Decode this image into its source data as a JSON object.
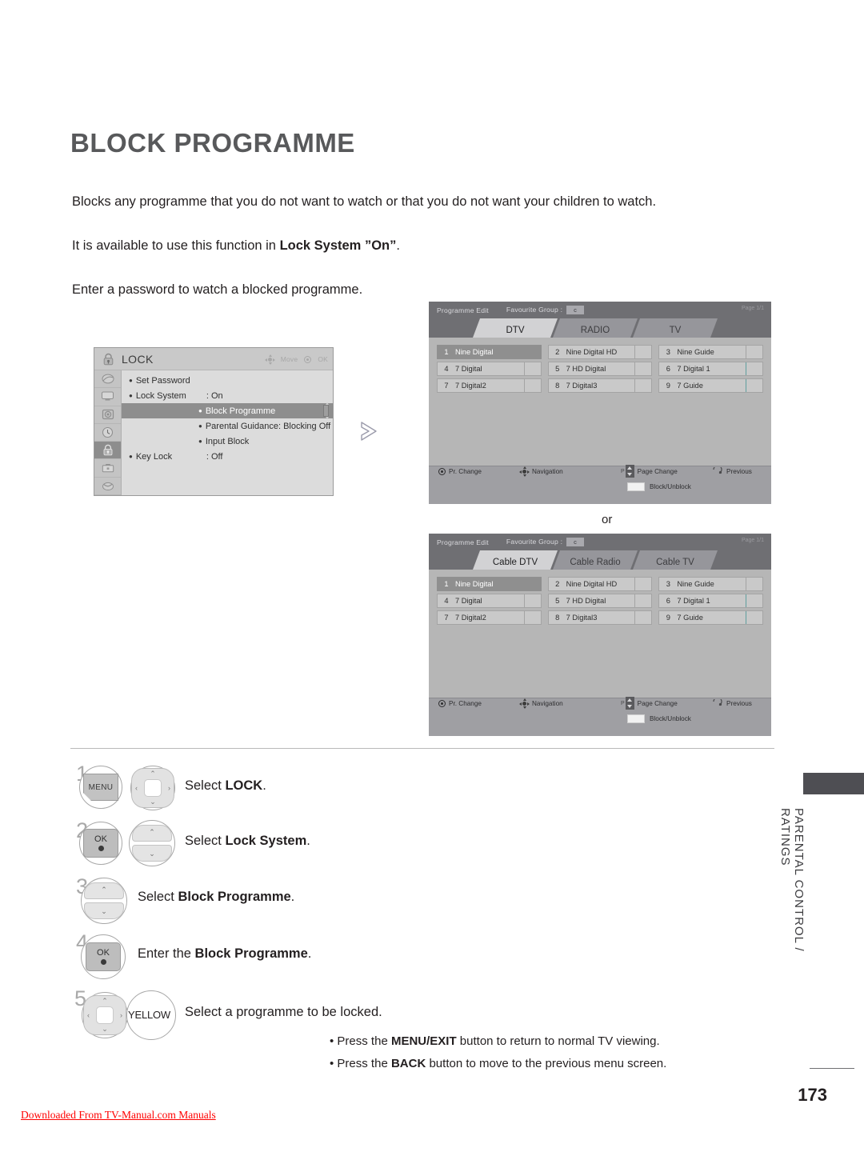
{
  "document": {
    "title": "BLOCK PROGRAMME",
    "intro": [
      "Blocks any programme that you do not want to watch or that you do not want your children to watch.",
      "It is available to use this function in ",
      "Enter a password to watch a blocked programme."
    ],
    "intro_bold": "Lock System ”On”",
    "intro_tail": ".",
    "page_number": "173",
    "download_note": "Downloaded From TV-Manual.com Manuals",
    "or_label": "or"
  },
  "side_tab": {
    "line1": "PARENTAL CONTROL /",
    "line2": "RATINGS"
  },
  "lock_menu": {
    "title": "LOCK",
    "hint_move": "Move",
    "hint_ok": "OK",
    "rail_icons": [
      "picture-icon",
      "screen-icon",
      "audio-icon",
      "time-icon",
      "lock-icon",
      "option-icon",
      "usb-icon"
    ],
    "items": [
      {
        "label": "Set Password",
        "value": "",
        "indent": false,
        "selected": false
      },
      {
        "label": "Lock System",
        "value": ": On",
        "indent": false,
        "selected": false
      },
      {
        "label": "Block Programme",
        "value": "",
        "indent": true,
        "selected": true
      },
      {
        "label": "Parental Guidance: Blocking Off",
        "value": "",
        "indent": true,
        "selected": false
      },
      {
        "label": "Input Block",
        "value": "",
        "indent": true,
        "selected": false
      },
      {
        "label": "Key Lock",
        "value": ": Off",
        "indent": false,
        "selected": false
      }
    ]
  },
  "tv_screens": [
    {
      "id": "dtv",
      "header_title": "Programme Edit",
      "fav_label": "Favourite Group :",
      "fav_value": "c",
      "page_label": "Page 1/1",
      "tabs": [
        {
          "label": "DTV",
          "active": true
        },
        {
          "label": "RADIO",
          "active": false
        },
        {
          "label": "TV",
          "active": false
        }
      ],
      "programmes": [
        {
          "num": "1",
          "name": "Nine Digital",
          "selected": true
        },
        {
          "num": "2",
          "name": "Nine Digital HD",
          "selected": false
        },
        {
          "num": "3",
          "name": "Nine Guide",
          "selected": false
        },
        {
          "num": "4",
          "name": "7 Digital",
          "selected": false
        },
        {
          "num": "5",
          "name": "7 HD Digital",
          "selected": false
        },
        {
          "num": "6",
          "name": "7 Digital 1",
          "selected": false
        },
        {
          "num": "7",
          "name": "7 Digital2",
          "selected": false
        },
        {
          "num": "8",
          "name": "7 Digital3",
          "selected": false
        },
        {
          "num": "9",
          "name": "7 Guide",
          "selected": false
        }
      ],
      "hints": [
        "Pr. Change",
        "Navigation",
        "Page Change",
        "Previous",
        "Block/Unblock"
      ],
      "page_prefix": "P"
    },
    {
      "id": "cable",
      "header_title": "Programme Edit",
      "fav_label": "Favourite Group :",
      "fav_value": "c",
      "page_label": "Page 1/1",
      "tabs": [
        {
          "label": "Cable DTV",
          "active": true
        },
        {
          "label": "Cable Radio",
          "active": false
        },
        {
          "label": "Cable TV",
          "active": false
        }
      ],
      "programmes": [
        {
          "num": "1",
          "name": "Nine Digital",
          "selected": true
        },
        {
          "num": "2",
          "name": "Nine Digital HD",
          "selected": false
        },
        {
          "num": "3",
          "name": "Nine Guide",
          "selected": false
        },
        {
          "num": "4",
          "name": "7 Digital",
          "selected": false
        },
        {
          "num": "5",
          "name": "7 HD Digital",
          "selected": false
        },
        {
          "num": "6",
          "name": "7 Digital 1",
          "selected": false
        },
        {
          "num": "7",
          "name": "7 Digital2",
          "selected": false
        },
        {
          "num": "8",
          "name": "7 Digital3",
          "selected": false
        },
        {
          "num": "9",
          "name": "7 Guide",
          "selected": false
        }
      ],
      "hints": [
        "Pr. Change",
        "Navigation",
        "Page Change",
        "Previous",
        "Block/Unblock"
      ],
      "page_prefix": "P"
    }
  ],
  "steps": [
    {
      "num": "1",
      "text_plain": "Select ",
      "text_bold": "LOCK",
      "text_tail": ".",
      "buttons": [
        "MENU",
        "dpad"
      ]
    },
    {
      "num": "2",
      "text_plain": "Select ",
      "text_bold": "Lock System",
      "text_tail": ".",
      "buttons": [
        "OK",
        "updown"
      ]
    },
    {
      "num": "3",
      "text_plain": "Select ",
      "text_bold": "Block Programme",
      "text_tail": ".",
      "buttons": [
        "updown"
      ]
    },
    {
      "num": "4",
      "text_plain": "Enter the ",
      "text_bold": "Block Programme",
      "text_tail": ".",
      "buttons": [
        "OK"
      ]
    },
    {
      "num": "5",
      "text_plain": "Select a programme to be locked.",
      "text_bold": "",
      "text_tail": "",
      "buttons": [
        "dpad",
        "YELLOW"
      ]
    }
  ],
  "button_labels": {
    "menu": "MENU",
    "ok": "OK",
    "yellow": "YELLOW"
  },
  "notes": [
    {
      "pre": "• Press the ",
      "bold": "MENU/EXIT",
      "post": " button to return to normal TV viewing."
    },
    {
      "pre": "• Press the ",
      "bold": "BACK",
      "post": " button to move to the previous menu screen."
    }
  ]
}
